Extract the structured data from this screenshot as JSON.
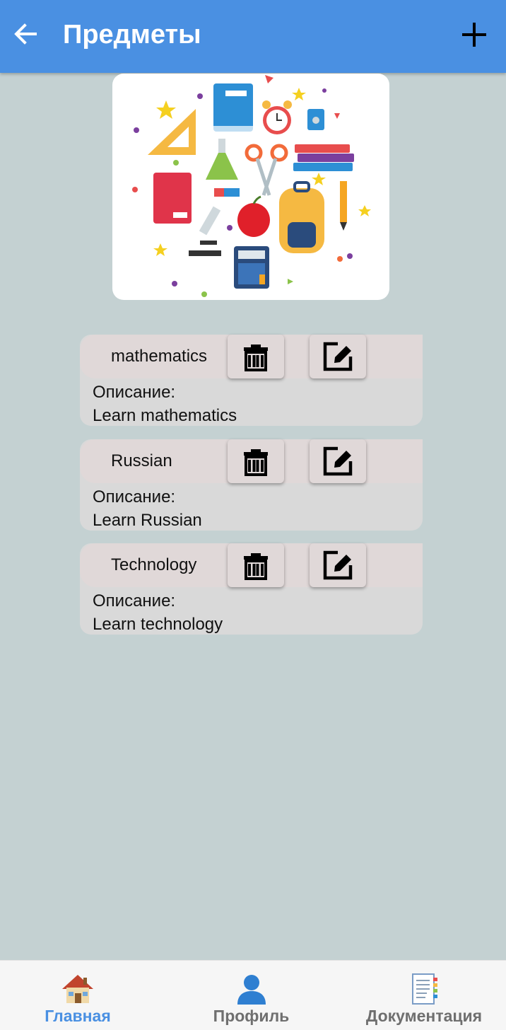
{
  "header": {
    "title": "Предметы",
    "back_icon": "arrow-left-icon",
    "add_icon": "plus-icon",
    "bg_color": "#4a90e2"
  },
  "hero": {
    "icon": "school-supplies-illustration"
  },
  "subjects": [
    {
      "name": "mathematics",
      "description_label": "Описание:",
      "description": "Learn mathematics"
    },
    {
      "name": "Russian",
      "description_label": "Описание:",
      "description": "Learn Russian"
    },
    {
      "name": "Technology",
      "description_label": "Описание:",
      "description": "Learn technology"
    }
  ],
  "actions": {
    "delete_icon": "trash-icon",
    "edit_icon": "edit-icon"
  },
  "bottom_nav": {
    "items": [
      {
        "label": "Главная",
        "icon": "house-icon",
        "active": true
      },
      {
        "label": "Профиль",
        "icon": "user-icon",
        "active": false
      },
      {
        "label": "Документация",
        "icon": "document-icon",
        "active": false
      }
    ],
    "active_color": "#4a90e2"
  }
}
